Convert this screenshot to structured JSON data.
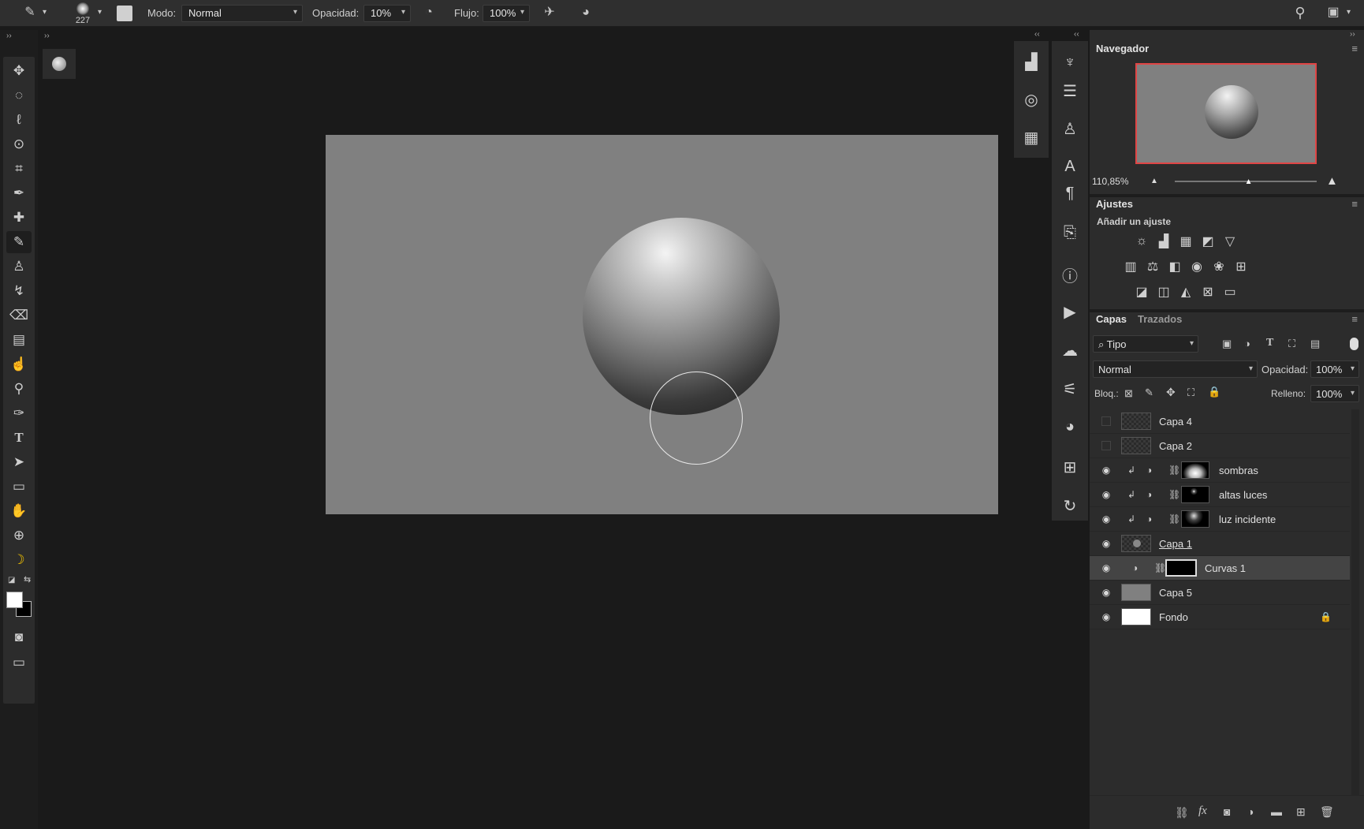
{
  "options_bar": {
    "brush_size": "227",
    "mode_label": "Modo:",
    "mode_value": "Normal",
    "opacity_label": "Opacidad:",
    "opacity_value": "10%",
    "flow_label": "Flujo:",
    "flow_value": "100%"
  },
  "navigator": {
    "title": "Navegador",
    "zoom": "110,85%",
    "zoom_slider_fraction": 0.52
  },
  "adjustments": {
    "title": "Ajustes",
    "subtitle": "Añadir un ajuste"
  },
  "layers_panel": {
    "tabs": [
      "Capas",
      "Trazados"
    ],
    "filter_value": "Tipo",
    "blend_mode": "Normal",
    "opacity_label": "Opacidad:",
    "opacity_value": "100%",
    "lock_label": "Bloq.:",
    "fill_label": "Relleno:",
    "fill_value": "100%",
    "layers": [
      {
        "name": "Capa 4",
        "visible": false
      },
      {
        "name": "Capa 2",
        "visible": false
      },
      {
        "name": "sombras",
        "visible": true
      },
      {
        "name": "altas luces",
        "visible": true
      },
      {
        "name": "luz incidente",
        "visible": true
      },
      {
        "name": "Capa 1",
        "visible": true
      },
      {
        "name": "Curvas 1",
        "visible": true,
        "selected": true
      },
      {
        "name": "Capa 5",
        "visible": true
      },
      {
        "name": "Fondo",
        "visible": true,
        "locked": true
      }
    ]
  },
  "colors": {
    "navigator_frame": "#e04545",
    "canvas_gray": "#808080",
    "panel_bg": "#2c2c2c"
  }
}
